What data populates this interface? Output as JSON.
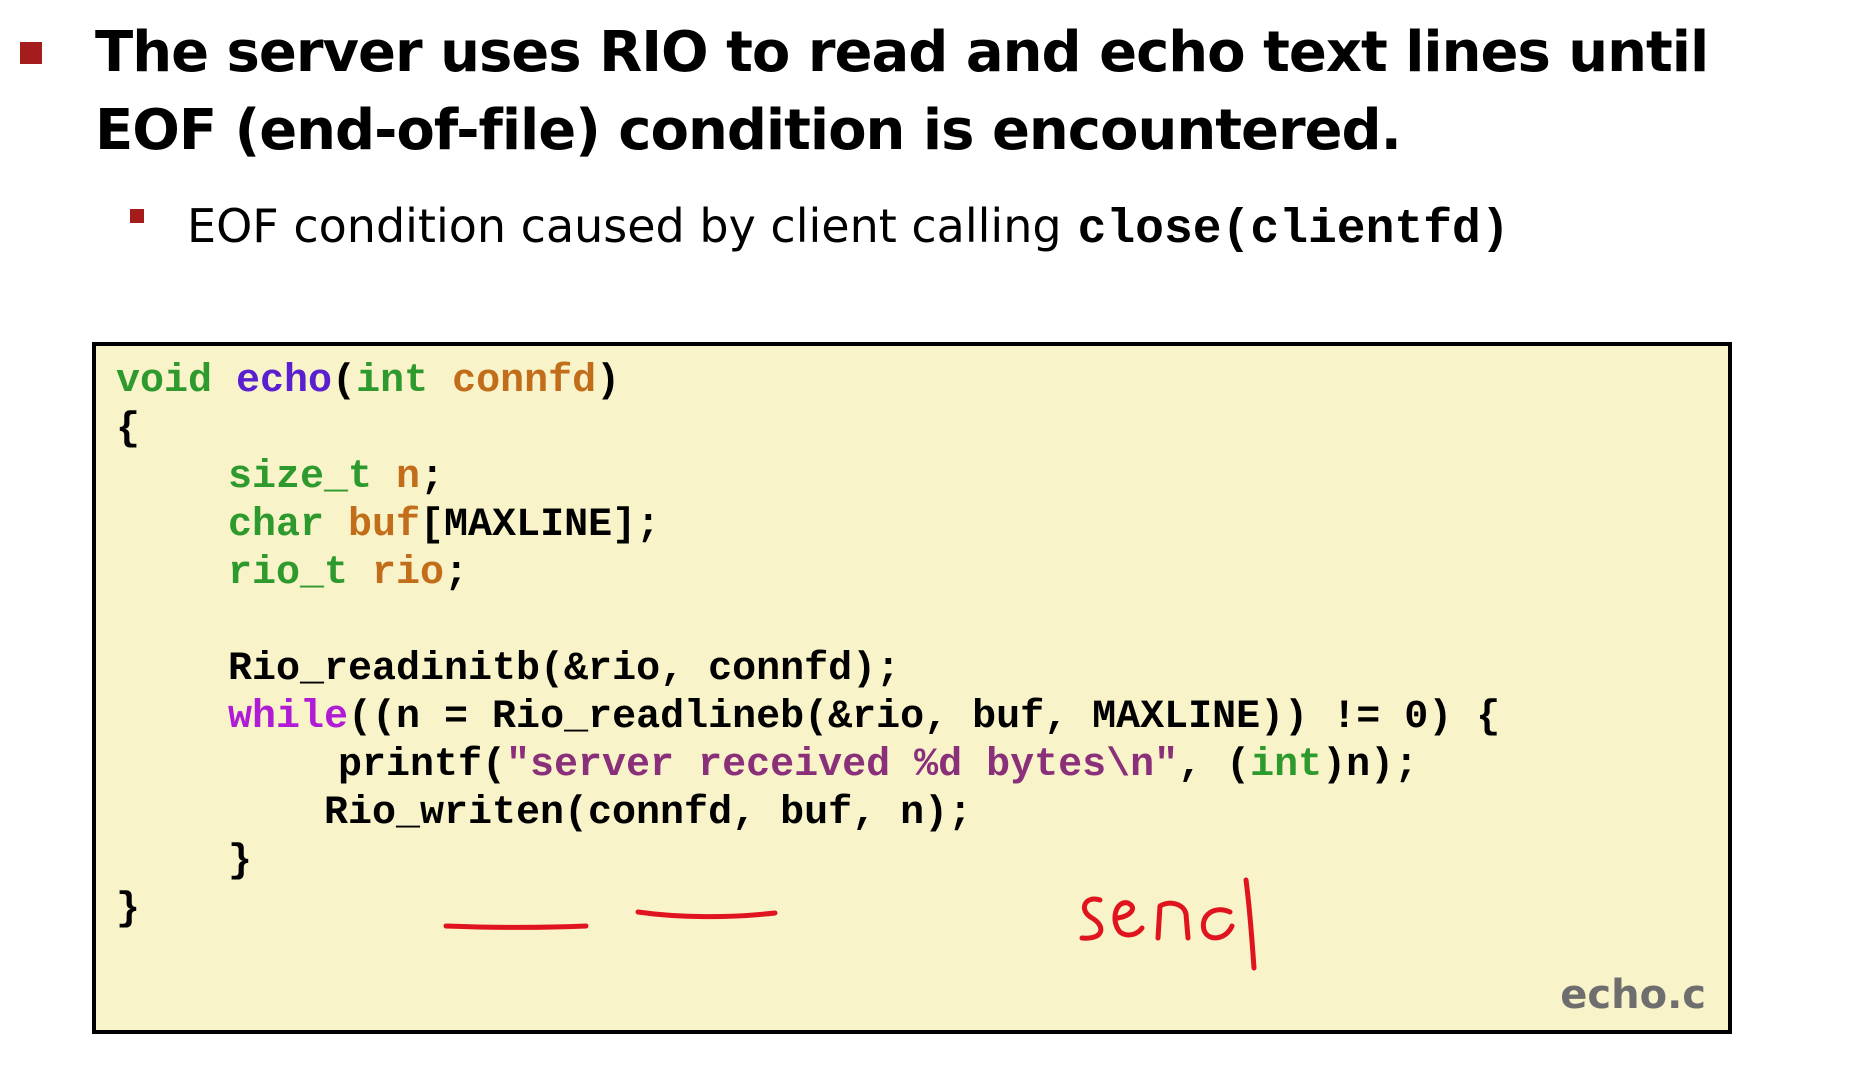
{
  "main_bullet": {
    "text": "The server uses RIO to read and echo text lines until EOF (end-of-file) condition is encountered."
  },
  "sub_bullet": {
    "text": "EOF condition caused by client calling",
    "code": "close(clientfd)"
  },
  "code": {
    "line1": {
      "kw": "void",
      "fn": "echo",
      "open": "(",
      "type": "int",
      "param": "connfd",
      "close": ")"
    },
    "line2": {
      "text": "{"
    },
    "line3": {
      "type": "size_t",
      "var": "n",
      "end": ";"
    },
    "line4": {
      "type": "char",
      "var": "buf",
      "rest": "[MAXLINE];"
    },
    "line5": {
      "type": "rio_t",
      "var": "rio",
      "end": ";"
    },
    "line6": {
      "text": "Rio_readinitb(&rio, connfd);"
    },
    "line7": {
      "kw": "while",
      "rest": "((n = Rio_readlineb(&rio, buf, MAXLINE)) != 0) {"
    },
    "line8": {
      "fn": "printf(",
      "str": "\"server received %d bytes\\n\"",
      "mid": ", (",
      "type": "int",
      "end": ")n);"
    },
    "line9": {
      "text": "Rio_writen(connfd, buf, n);"
    },
    "line10": {
      "text": "}"
    },
    "line11": {
      "text": "}"
    }
  },
  "filename": "echo.c",
  "annotation": {
    "text": "send",
    "color": "#e0141e"
  },
  "colors": {
    "bullet": "#a51c1c",
    "code_bg": "#f8f3c8",
    "keyword": "#2e9a2e",
    "variable": "#c26d1a",
    "function": "#5a1fcf",
    "control": "#b01cd6",
    "string": "#8a2f7a"
  }
}
